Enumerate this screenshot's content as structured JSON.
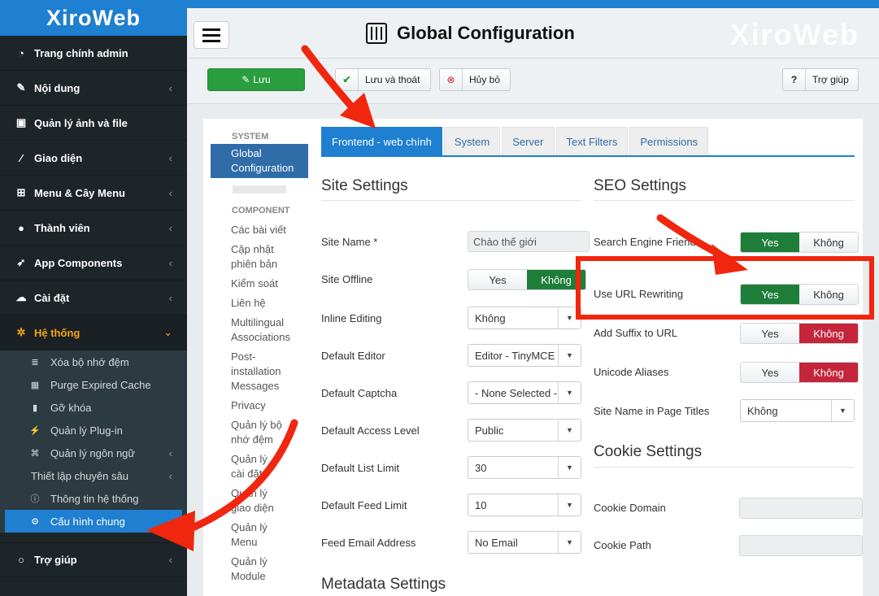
{
  "brand": "XiroWeb",
  "watermark": "XiroWeb",
  "page_title": "Global Configuration",
  "sidebar": {
    "items": [
      {
        "label": "Trang chính admin",
        "icon": "dashboard-icon",
        "chevron": false
      },
      {
        "label": "Nội dung",
        "icon": "edit-icon",
        "chevron": true
      },
      {
        "label": "Quản lý ảnh và file",
        "icon": "image-icon",
        "chevron": false
      },
      {
        "label": "Giao diện",
        "icon": "magic-wand-icon",
        "chevron": true
      },
      {
        "label": "Menu & Cây Menu",
        "icon": "sitemap-icon",
        "chevron": true
      },
      {
        "label": "Thành viên",
        "icon": "user-icon",
        "chevron": true
      },
      {
        "label": "App Components",
        "icon": "rocket-icon",
        "chevron": true
      },
      {
        "label": "Cài đặt",
        "icon": "cloud-download-icon",
        "chevron": true
      },
      {
        "label": "Hệ thống",
        "icon": "gear-icon",
        "chevron": true
      }
    ],
    "sub_items": [
      {
        "label": "Xóa bộ nhớ đệm",
        "icon": "database-icon"
      },
      {
        "label": "Purge Expired Cache",
        "icon": "calendar-icon"
      },
      {
        "label": "Gỡ khóa",
        "icon": "lock-icon"
      },
      {
        "label": "Quản lý Plug-in",
        "icon": "plug-icon"
      },
      {
        "label": "Quản lý ngôn ngữ",
        "icon": "language-icon"
      },
      {
        "label": "Thiết lập chuyên sâu",
        "icon": ""
      },
      {
        "label": "Thông tin hệ thống",
        "icon": "info-icon"
      },
      {
        "label": "Cấu hình chung",
        "icon": "gears-icon"
      }
    ],
    "help": "Trợ giúp"
  },
  "toolbar": {
    "save": "Lưu",
    "save_close": "Lưu và thoát",
    "cancel": "Hủy bỏ",
    "help": "Trợ giúp"
  },
  "left_nav": {
    "system_header": "SYSTEM",
    "active": "Global Configuration",
    "component_header": "COMPONENT",
    "links": [
      "Các bài viết",
      "Cập nhật phiên bản",
      "Kiểm soát",
      "Liên hệ",
      "Multilingual Associations",
      "Post-installation Messages",
      "Privacy",
      "Quản lý bộ nhớ đệm",
      "Quản lý cài đặt",
      "Quản lý giao diện",
      "Quản lý Menu",
      "Quản lý Module"
    ]
  },
  "tabs": [
    "Frontend - web chính",
    "System",
    "Server",
    "Text Filters",
    "Permissions"
  ],
  "site_settings": {
    "title": "Site Settings",
    "site_name_label": "Site Name *",
    "site_name_value": "Chào thế giới",
    "site_offline_label": "Site Offline",
    "site_offline_yes": "Yes",
    "site_offline_no": "Không",
    "inline_editing_label": "Inline Editing",
    "inline_editing_value": "Không",
    "default_editor_label": "Default Editor",
    "default_editor_value": "Editor - TinyMCE",
    "default_captcha_label": "Default Captcha",
    "default_captcha_value": "- None Selected -",
    "default_access_label": "Default Access Level",
    "default_access_value": "Public",
    "list_limit_label": "Default List Limit",
    "list_limit_value": "30",
    "feed_limit_label": "Default Feed Limit",
    "feed_limit_value": "10",
    "feed_email_label": "Feed Email Address",
    "feed_email_value": "No Email"
  },
  "metadata_title": "Metadata Settings",
  "seo_settings": {
    "title": "SEO Settings",
    "sef_label": "Search Engine Friendly URLs",
    "url_rewriting_label": "Use URL Rewriting",
    "suffix_label": "Add Suffix to URL",
    "unicode_label": "Unicode Aliases",
    "site_name_titles_label": "Site Name in Page Titles",
    "site_name_titles_value": "Không",
    "yes": "Yes",
    "no": "Không"
  },
  "cookie_settings": {
    "title": "Cookie Settings",
    "domain_label": "Cookie Domain",
    "path_label": "Cookie Path"
  },
  "colors": {
    "brand_blue": "#1f7fd0",
    "toggle_green": "#1f7d3a",
    "toggle_red": "#c4253a",
    "annotation_red": "#f0260f"
  }
}
